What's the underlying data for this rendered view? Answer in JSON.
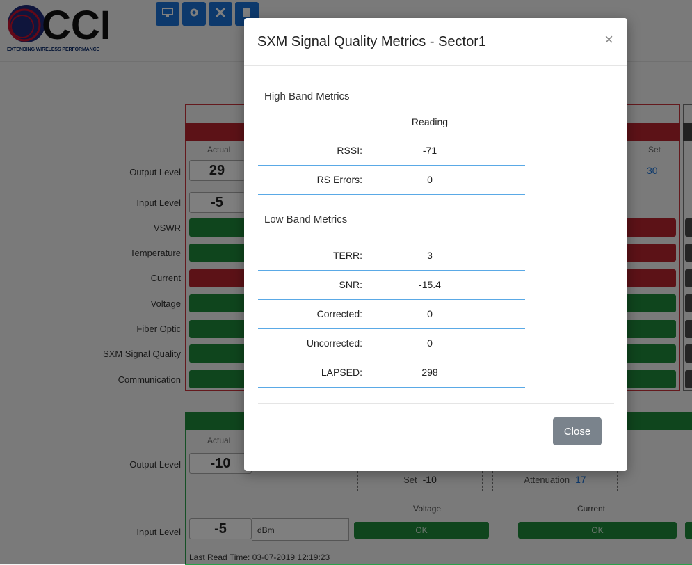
{
  "logo": {
    "text": "CCI",
    "tagline": "EXTENDING WIRELESS PERFORMANCE"
  },
  "toolbar": {
    "icons": [
      "monitor-icon",
      "gear-icon",
      "wrench-icon",
      "document-icon"
    ]
  },
  "background": {
    "col_actual": "Actual",
    "col_set": "Set",
    "set_value": "30",
    "rows": {
      "output_level": "Output Level",
      "input_level": "Input Level",
      "vswr": "VSWR",
      "temperature": "Temperature",
      "current": "Current",
      "voltage": "Voltage",
      "fiber_optic": "Fiber Optic",
      "sxm": "SXM Signal Quality",
      "communication": "Communication"
    },
    "actual_output": "29",
    "actual_input": "-5",
    "lower": {
      "col_actual": "Actual",
      "output_label": "Output Level",
      "output_value": "-10",
      "set_label": "Set",
      "set_value": "-10",
      "atten_label": "Attenuation",
      "atten_value": "17",
      "voltage_label": "Voltage",
      "current_label": "Current",
      "ok1": "OK",
      "ok2": "OK",
      "input_label": "Input Level",
      "input_value": "-5",
      "unit": "dBm",
      "last_read": "Last Read Time: 03-07-2019 12:19:23"
    }
  },
  "modal": {
    "title": "SXM Signal Quality Metrics - Sector1",
    "close_x": "×",
    "high_band_title": "High Band Metrics",
    "reading_header": "Reading",
    "high_band": [
      {
        "label": "RSSI:",
        "value": "-71"
      },
      {
        "label": "RS Errors:",
        "value": "0"
      }
    ],
    "low_band_title": "Low Band Metrics",
    "low_band": [
      {
        "label": "TERR:",
        "value": "3"
      },
      {
        "label": "SNR:",
        "value": "-15.4"
      },
      {
        "label": "Corrected:",
        "value": "0"
      },
      {
        "label": "Uncorrected:",
        "value": "0"
      },
      {
        "label": "LAPSED:",
        "value": "298"
      }
    ],
    "close_button": "Close"
  },
  "colors": {
    "green": "#1e8a3a",
    "red": "#b8242e",
    "accent": "#1a73d9",
    "close_button": "#7a838c"
  }
}
